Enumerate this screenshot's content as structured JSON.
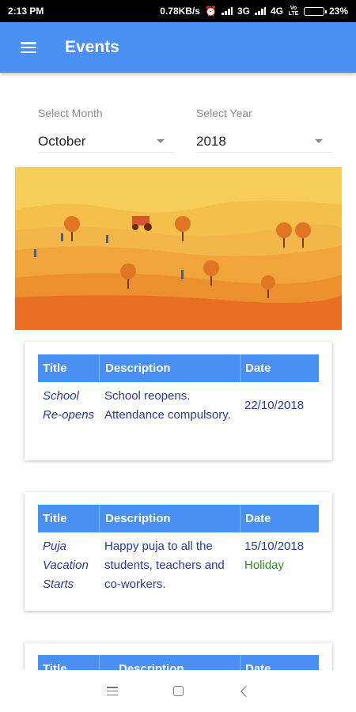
{
  "status_bar": {
    "time": "2:13 PM",
    "speed": "0.78KB/s",
    "network_1": "3G",
    "network_2": "4G",
    "volte": "Vo LTE",
    "battery": "23%",
    "battery_level": 0.23
  },
  "app_bar": {
    "title": "Events",
    "menu_icon": "hamburger-menu-icon",
    "background": "#4a8ff2"
  },
  "filters": {
    "month": {
      "label": "Select Month",
      "value": "October"
    },
    "year": {
      "label": "Select Year",
      "value": "2018"
    }
  },
  "banner": {
    "description_icon": "autumn-landscape-illustration"
  },
  "table_headers": [
    "Title",
    "Description",
    "Date"
  ],
  "events": [
    {
      "title": "School Re-opens",
      "description": "School reopens. Attendance compulsory.",
      "date": "22/10/2018",
      "tag": ""
    },
    {
      "title": "Puja Vacation Starts",
      "description": "Happy puja to all the students, teachers and co-workers.",
      "date": "15/10/2018",
      "tag": "Holiday"
    },
    {
      "title": "",
      "description": "",
      "date": "",
      "tag": ""
    }
  ],
  "colors": {
    "accent": "#4a8ff2",
    "event_text": "#2a3a93",
    "holiday": "#2e8b2e"
  },
  "nav_bar": {
    "menu_icon": "recent-apps-icon",
    "home_icon": "home-square-icon",
    "back_icon": "back-chevron-icon"
  }
}
